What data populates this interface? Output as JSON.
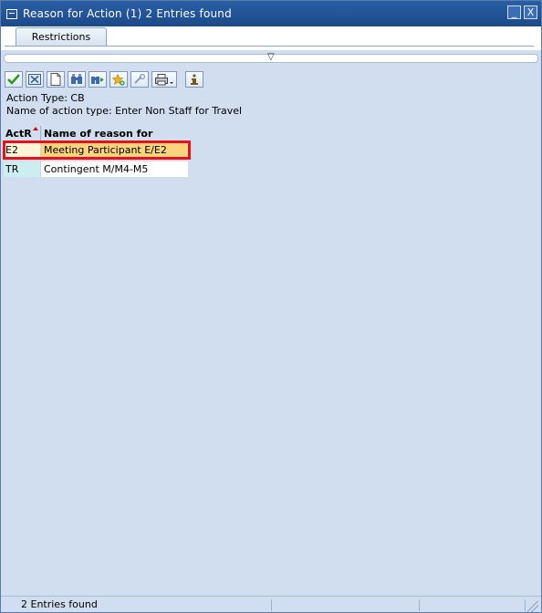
{
  "window": {
    "title": "Reason for Action (1)     2 Entries found"
  },
  "tabs": [
    {
      "label": "Restrictions"
    }
  ],
  "toolbar": {
    "buttons": [
      {
        "icon": "check-icon"
      },
      {
        "icon": "cancel-icon"
      },
      {
        "icon": "new-document-icon"
      },
      {
        "icon": "find-icon"
      },
      {
        "icon": "find-next-icon"
      },
      {
        "icon": "add-favorite-icon"
      },
      {
        "icon": "help-icon"
      },
      {
        "icon": "print-icon"
      },
      {
        "icon": "info-icon"
      }
    ]
  },
  "info": {
    "action_type": "Action Type: CB",
    "action_type_name": "Name of action type: Enter Non Staff for Travel"
  },
  "table": {
    "columns": [
      "ActR",
      "Name of reason for action"
    ],
    "rows": [
      {
        "code": "E2",
        "name": "Meeting Participant E/E2",
        "selected": true
      },
      {
        "code": "TR",
        "name": "Contingent M/M4-M5",
        "selected": false
      }
    ]
  },
  "status": {
    "text": "2 Entries found"
  },
  "colors": {
    "titlebar": "#1c4a8a",
    "background": "#d1deef",
    "highlight_border": "#e8101a",
    "selected_row": "#fbd37e",
    "key_cell": "#cdeef0"
  }
}
